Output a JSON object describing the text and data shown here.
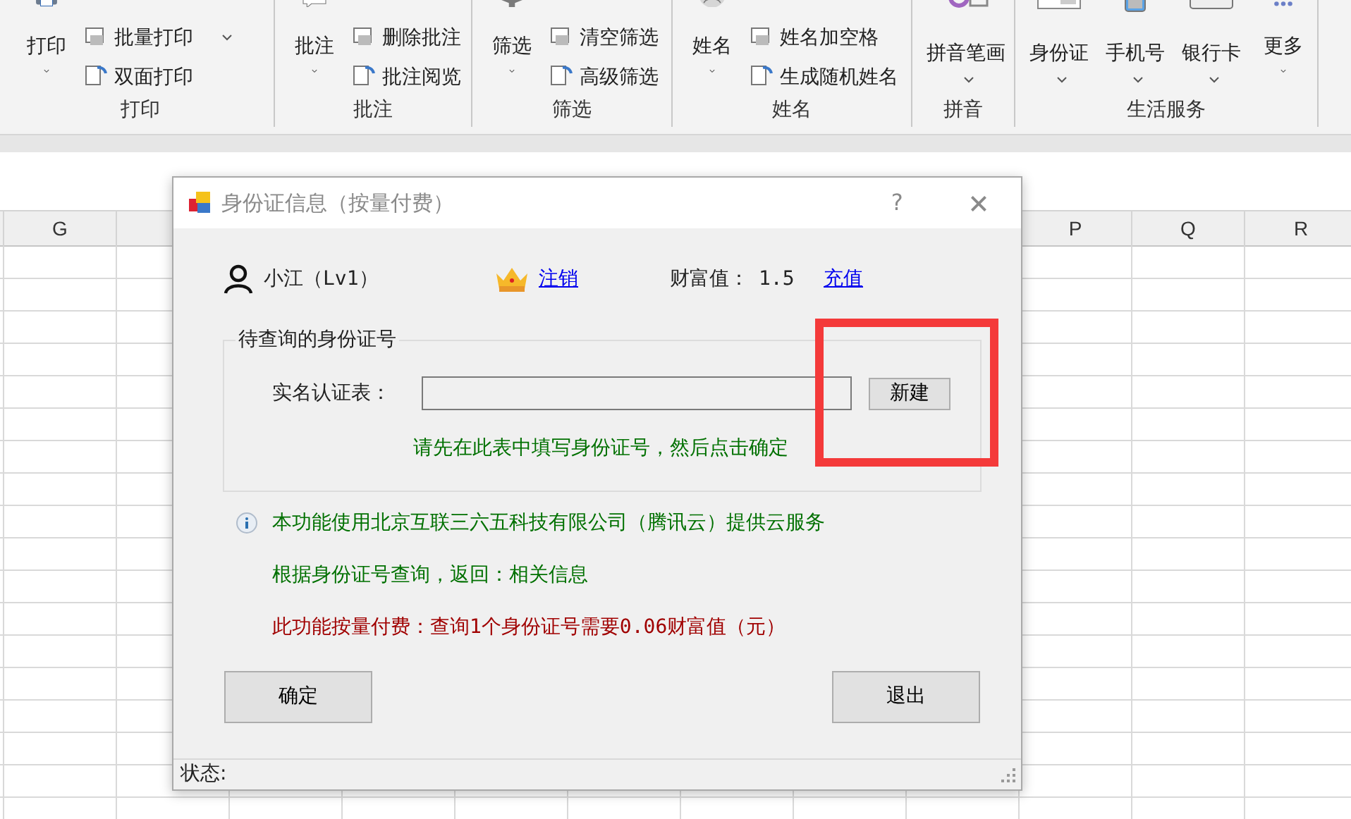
{
  "ribbon": {
    "groups": [
      {
        "label": "打印",
        "items": [
          {
            "kind": "large",
            "label": "打印",
            "caret": true
          },
          {
            "kind": "small",
            "label": "批量打印",
            "caret": true
          },
          {
            "kind": "small",
            "label": "双面打印",
            "caret": false
          }
        ]
      },
      {
        "label": "批注",
        "items": [
          {
            "kind": "large",
            "label": "批注",
            "caret": true
          },
          {
            "kind": "small",
            "label": "删除批注",
            "caret": false
          },
          {
            "kind": "small",
            "label": "批注阅览",
            "caret": false
          }
        ]
      },
      {
        "label": "筛选",
        "items": [
          {
            "kind": "large",
            "label": "筛选",
            "caret": true
          },
          {
            "kind": "small",
            "label": "清空筛选",
            "caret": false
          },
          {
            "kind": "small",
            "label": "高级筛选",
            "caret": false
          }
        ]
      },
      {
        "label": "姓名",
        "items": [
          {
            "kind": "large",
            "label": "姓名",
            "caret": true
          },
          {
            "kind": "small",
            "label": "姓名加空格",
            "caret": false
          },
          {
            "kind": "small",
            "label": "生成随机姓名",
            "caret": false
          }
        ]
      },
      {
        "label": "拼音",
        "items": [
          {
            "kind": "large",
            "label": "拼音笔画",
            "caret": true
          }
        ]
      },
      {
        "label": "生活服务",
        "items": [
          {
            "kind": "large",
            "label": "身份证",
            "caret": true
          },
          {
            "kind": "large",
            "label": "手机号",
            "caret": true
          },
          {
            "kind": "large",
            "label": "银行卡",
            "caret": true
          },
          {
            "kind": "large",
            "label": "更多",
            "caret": true
          }
        ]
      }
    ]
  },
  "sheet": {
    "column_headers": [
      "G",
      "P",
      "Q",
      "R"
    ]
  },
  "dialog": {
    "title": "身份证信息（按量付费）",
    "help": "?",
    "close": "×",
    "user": "小江（Lv1）",
    "logout_link": "注销",
    "wealth_label": "财富值：",
    "wealth_value": "1.5",
    "recharge_link": "充值",
    "group_title": "待查询的身份证号",
    "table_label": "实名认证表：",
    "new_button": "新建",
    "hint": "请先在此表中填写身份证号，然后点击确定",
    "notes": [
      {
        "kind": "info",
        "text": "本功能使用北京互联三六五科技有限公司（腾讯云）提供云服务"
      },
      {
        "kind": "plain",
        "text": "根据身份证号查询，返回：相关信息"
      },
      {
        "kind": "price",
        "text": "此功能按量付费：查询1个身份证号需要0.06财富值（元）"
      }
    ],
    "ok_button": "确定",
    "exit_button": "退出",
    "status_label": "状态:"
  }
}
